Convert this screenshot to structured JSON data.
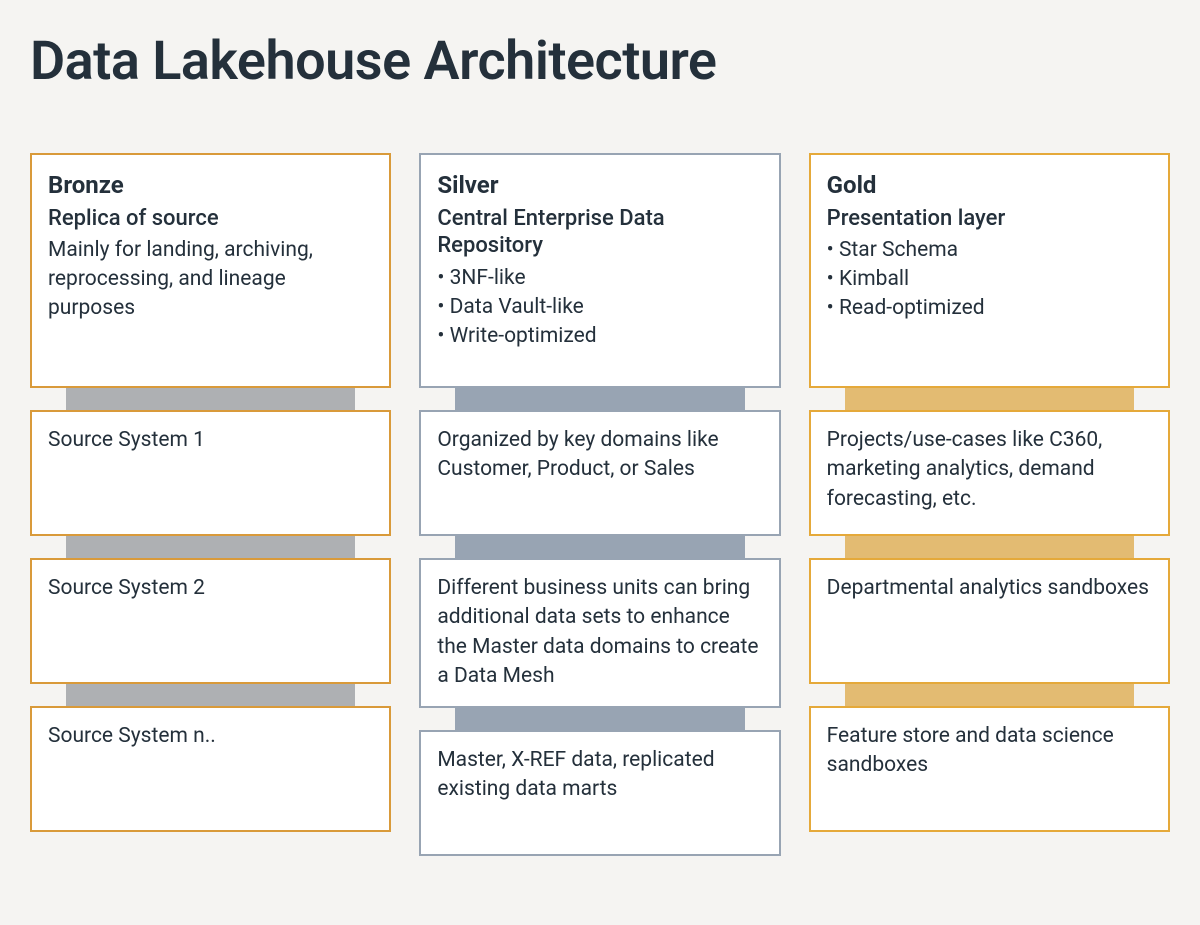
{
  "title": "Data Lakehouse Architecture",
  "columns": {
    "bronze": {
      "header": {
        "title": "Bronze",
        "subtitle": "Replica of source",
        "description": "Mainly for landing, archiving, reprocessing, and lineage purposes"
      },
      "cells": [
        "Source System 1",
        "Source System 2",
        "Source System n.."
      ]
    },
    "silver": {
      "header": {
        "title": "Silver",
        "subtitle": "Central Enterprise Data Repository",
        "bullets": [
          "3NF-like",
          "Data Vault-like",
          "Write-optimized"
        ]
      },
      "cells": [
        "Organized by key domains like Customer, Product, or Sales",
        "Different business units can bring additional data sets to enhance the Master data domains to create a Data Mesh",
        "Master, X-REF data, replicated existing data marts"
      ]
    },
    "gold": {
      "header": {
        "title": "Gold",
        "subtitle": "Presentation layer",
        "bullets": [
          "Star Schema",
          "Kimball",
          "Read-optimized"
        ]
      },
      "cells": [
        "Projects/use-cases like C360, marketing analytics, demand forecasting, etc.",
        "Departmental analytics sandboxes",
        "Feature store and data science sandboxes"
      ]
    }
  },
  "colors": {
    "bronze_border": "#d99a3a",
    "silver_border": "#98a4b3",
    "gold_border": "#e5a93a",
    "gold_connector": "#e3bb72",
    "gray_connector": "#aeb0b3",
    "background": "#f5f4f2",
    "text": "#24303b"
  }
}
